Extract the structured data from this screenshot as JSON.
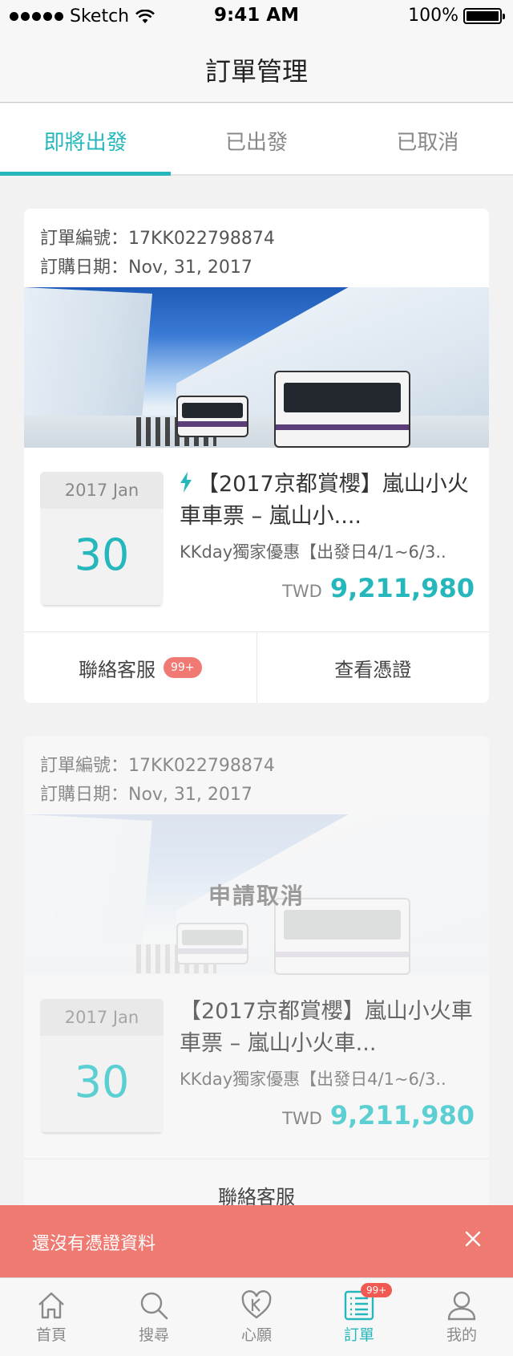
{
  "status_bar": {
    "carrier": "Sketch",
    "time": "9:41 AM",
    "battery": "100%"
  },
  "nav": {
    "title": "訂單管理"
  },
  "tabs": [
    {
      "label": "即將出發",
      "active": true
    },
    {
      "label": "已出發",
      "active": false
    },
    {
      "label": "已取消",
      "active": false
    }
  ],
  "orders": [
    {
      "order_no": "訂單編號：17KK022798874",
      "order_date": "訂購日期：Nov, 31, 2017",
      "month": "2017 Jan",
      "day": "30",
      "title": "【2017京都賞櫻】嵐山小火車車票 – 嵐山小....",
      "subtitle": "KKday獨家優惠【出發日4/1~6/3..",
      "currency": "TWD",
      "price": "9,211,980",
      "contact_label": "聯絡客服",
      "contact_badge": "99+",
      "voucher_label": "查看憑證",
      "icon": "lightning-icon"
    },
    {
      "order_no": "訂單編號：17KK022798874",
      "order_date": "訂購日期：Nov, 31, 2017",
      "overlay": "申請取消",
      "month": "2017 Jan",
      "day": "30",
      "title": "【2017京都賞櫻】嵐山小火車車票 – 嵐山小火車...",
      "subtitle": "KKday獨家優惠【出發日4/1~6/3..",
      "currency": "TWD",
      "price": "9,211,980",
      "contact_label": "聯絡客服"
    }
  ],
  "toast": {
    "message": "還沒有憑證資料",
    "close_icon": "close-icon"
  },
  "tab_bar": [
    {
      "label": "首頁",
      "icon": "home-icon"
    },
    {
      "label": "搜尋",
      "icon": "search-icon"
    },
    {
      "label": "心願",
      "icon": "heart-k-icon"
    },
    {
      "label": "訂單",
      "icon": "order-list-icon",
      "badge": "99+",
      "active": true
    },
    {
      "label": "我的",
      "icon": "user-icon"
    }
  ],
  "colors": {
    "accent": "#26b7bc",
    "toast": "#ef7a71",
    "badge": "#f05a52"
  }
}
